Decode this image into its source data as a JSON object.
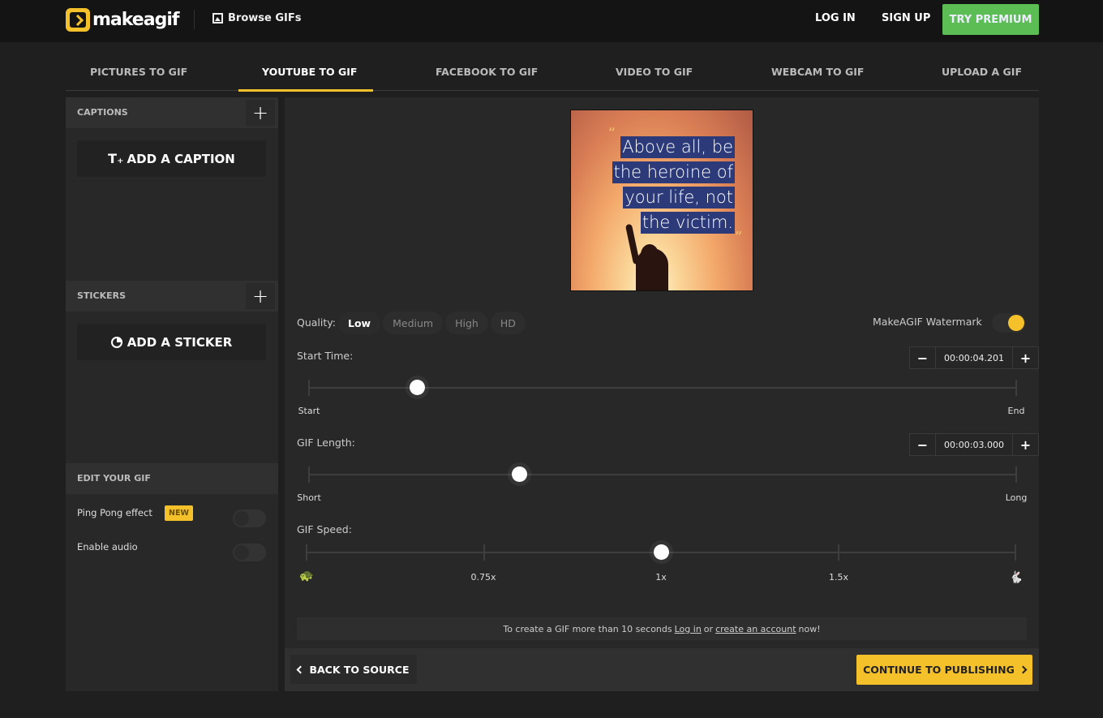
{
  "header": {
    "logo_text": "makeagif",
    "browse_label": "Browse GIFs",
    "login_label": "LOG IN",
    "signup_label": "SIGN UP",
    "premium_label": "TRY PREMIUM",
    "premium_color": "#5cbd55",
    "brand_color": "#f5c12a"
  },
  "tabs": [
    {
      "label": "PICTURES TO GIF",
      "active": false
    },
    {
      "label": "YOUTUBE TO GIF",
      "active": true
    },
    {
      "label": "FACEBOOK TO GIF",
      "active": false
    },
    {
      "label": "VIDEO TO GIF",
      "active": false
    },
    {
      "label": "WEBCAM TO GIF",
      "active": false
    },
    {
      "label": "UPLOAD A GIF",
      "active": false
    }
  ],
  "sidebar": {
    "captions": {
      "title": "CAPTIONS",
      "add_label": "ADD A CAPTION"
    },
    "stickers": {
      "title": "STICKERS",
      "add_label": "ADD A STICKER"
    },
    "edit": {
      "title": "EDIT YOUR GIF",
      "options": [
        {
          "label": "Ping Pong effect",
          "badge": "NEW",
          "enabled": false
        },
        {
          "label": "Enable audio",
          "enabled": false
        }
      ]
    }
  },
  "preview": {
    "quote_lines": [
      "Above all, be",
      "the heroine of",
      "your life, not",
      "the victim."
    ],
    "open_quote": "“",
    "close_quote": "”"
  },
  "controls": {
    "quality": {
      "label": "Quality:",
      "options": [
        "Low",
        "Medium",
        "High",
        "HD"
      ],
      "selected": "Low"
    },
    "watermark": {
      "label": "MakeAGIF Watermark",
      "enabled": true
    },
    "start_time": {
      "label": "Start Time:",
      "value": "00:00:04.201",
      "position_fraction": 0.153,
      "min_label": "Start",
      "max_label": "End"
    },
    "gif_length": {
      "label": "GIF Length:",
      "value": "00:00:03.000",
      "position_fraction": 0.297,
      "min_label": "Short",
      "max_label": "Long"
    },
    "gif_speed": {
      "label": "GIF Speed:",
      "stops": [
        "slow",
        "0.75x",
        "1x",
        "1.5x",
        "fast"
      ],
      "selected": "1x"
    }
  },
  "notice": {
    "prefix": "To create a GIF more than 10 seconds",
    "login_link": "Log in",
    "middle": "or",
    "account_link": "create an account",
    "suffix": "now!"
  },
  "footer": {
    "back_label": "BACK TO SOURCE",
    "continue_label": "CONTINUE TO PUBLISHING"
  }
}
